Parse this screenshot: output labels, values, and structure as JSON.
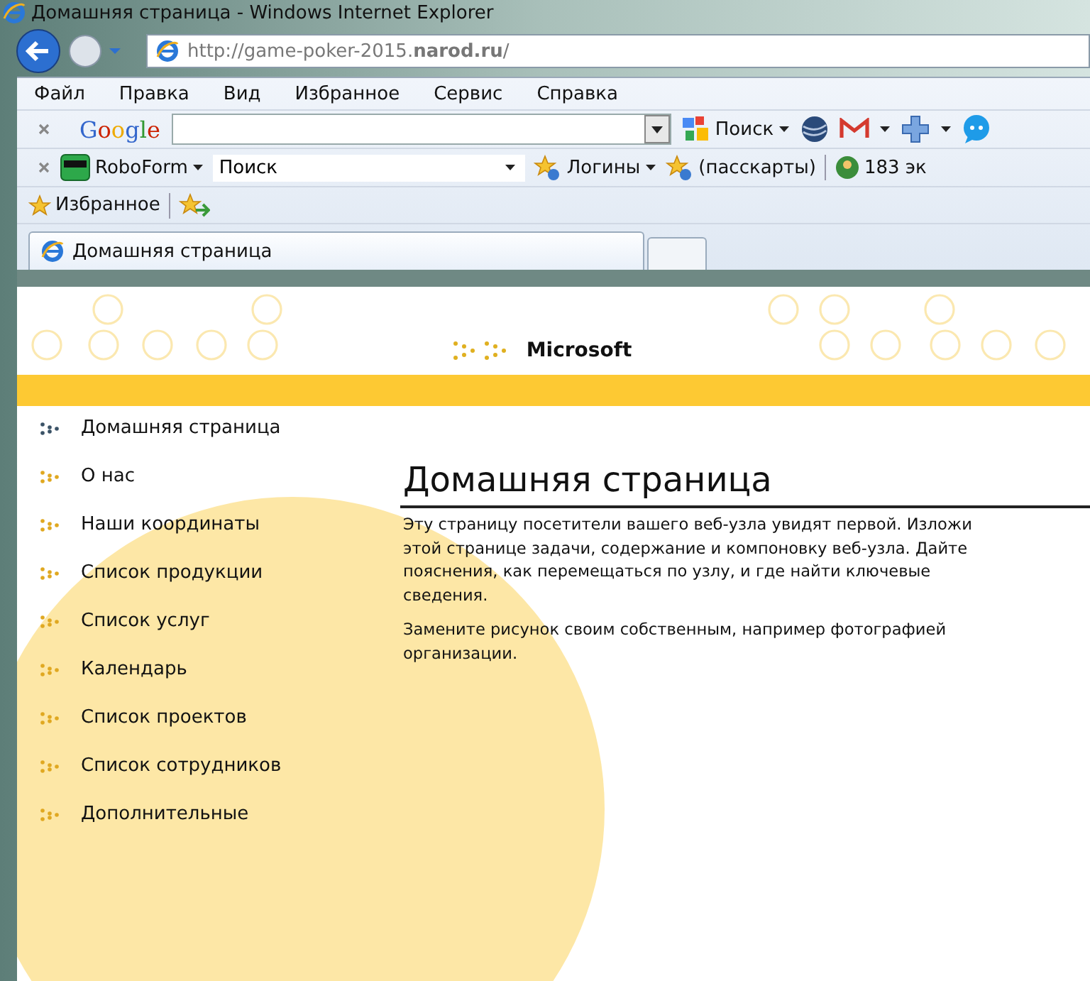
{
  "window": {
    "title": "Домашняя страница - Windows Internet Explorer"
  },
  "address_bar": {
    "url": "http://game-poker-2015.**narod.ru**/"
  },
  "menu": [
    "Файл",
    "Правка",
    "Вид",
    "Избранное",
    "Сервис",
    "Справка"
  ],
  "google_toolbar": {
    "logo": "Google",
    "search_button": "Поиск"
  },
  "roboform_toolbar": {
    "label": "RoboForm",
    "search": "Поиск",
    "logins": "Логины",
    "passcards": "(пасскарты)",
    "counter": "183 эк"
  },
  "favorites_bar": {
    "label": "Избранное"
  },
  "tabs": [
    {
      "label": "Домашняя страница",
      "selected": true
    }
  ],
  "page": {
    "logo": "Microsoft",
    "nav": [
      {
        "label": "Домашняя страница",
        "selected": true
      },
      {
        "label": "О нас",
        "selected": false
      },
      {
        "label": "Наши координаты",
        "selected": false
      },
      {
        "label": "Список продукции",
        "selected": false
      },
      {
        "label": "Список услуг",
        "selected": false
      },
      {
        "label": "Календарь",
        "selected": false
      },
      {
        "label": "Список проектов",
        "selected": false
      },
      {
        "label": "Список сотрудников",
        "selected": false
      },
      {
        "label": "Дополнительные",
        "selected": false
      }
    ],
    "heading": "Домашняя страница",
    "paragraphs": [
      "Эту страницу посетители вашего веб-узла увидят первой. Изложи\nэтой странице задачи, содержание и компоновку веб-узла. Дайте\nпояснения, как перемещаться по узлу, и где найти ключевые\nсведения.",
      "Замените рисунок своим собственным, например фотографией\nорганизации."
    ]
  }
}
